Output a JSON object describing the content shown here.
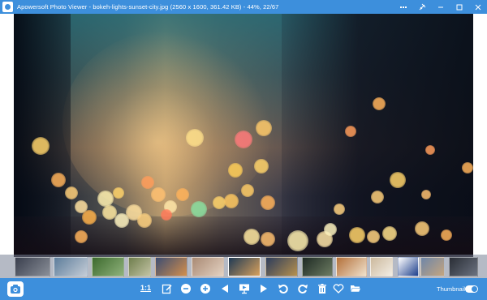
{
  "window": {
    "title": "Apowersoft Photo Viewer - bokeh-lights-sunset-city.jpg (2560 x 1600, 361.42 KB) - 44%, 22/67",
    "controls": [
      "multi-window-icon",
      "pin-icon",
      "minimize-icon",
      "maximize-icon",
      "close-icon"
    ]
  },
  "photo": {
    "name": "bokeh-lights-sunset-city.jpg"
  },
  "thumbnails": [
    {
      "name": "city-street",
      "colors": [
        "#3a3f4e",
        "#8a8f98"
      ]
    },
    {
      "name": "mountain-lake",
      "colors": [
        "#5d7d9b",
        "#c4ccd6"
      ]
    },
    {
      "name": "green-field",
      "colors": [
        "#3d6a2e",
        "#8fb27b"
      ]
    },
    {
      "name": "bird-branch",
      "colors": [
        "#6f7e4d",
        "#c3c3a4"
      ]
    },
    {
      "name": "sunset-harbor",
      "colors": [
        "#3c4d72",
        "#d48f4c"
      ]
    },
    {
      "name": "cat-face",
      "colors": [
        "#a98a74",
        "#e4d2c2"
      ]
    },
    {
      "name": "bokeh-lights-sunset-city",
      "colors": [
        "#1f3a55",
        "#d8a15c"
      ],
      "active": true
    },
    {
      "name": "night-bridge",
      "colors": [
        "#2c3c5c",
        "#b7914e"
      ]
    },
    {
      "name": "dark-plant",
      "colors": [
        "#1e2a24",
        "#6d7c62"
      ]
    },
    {
      "name": "food-plate",
      "colors": [
        "#b4703a",
        "#f0e2cc"
      ]
    },
    {
      "name": "dog-white",
      "colors": [
        "#ccb99d",
        "#f2ede4"
      ]
    },
    {
      "name": "video-camera-icon",
      "colors": [
        "#ffffff",
        "#1c3f8c"
      ]
    },
    {
      "name": "beach-people",
      "colors": [
        "#6e86a8",
        "#c5a57f"
      ]
    },
    {
      "name": "dark-room",
      "colors": [
        "#2a2e36",
        "#6b7280"
      ]
    }
  ],
  "toolbar": {
    "ratio_label": "1:1",
    "buttons": [
      "edit-icon",
      "zoom-out-icon",
      "zoom-in-icon",
      "previous-icon",
      "slideshow-icon",
      "next-icon",
      "rotate-left-icon",
      "rotate-right-icon",
      "delete-icon",
      "favorite-icon",
      "open-folder-icon"
    ],
    "thumbnail_label": "Thumbnail",
    "thumbnail_toggle": true
  },
  "colors": {
    "accent": "#3d8fdc"
  }
}
